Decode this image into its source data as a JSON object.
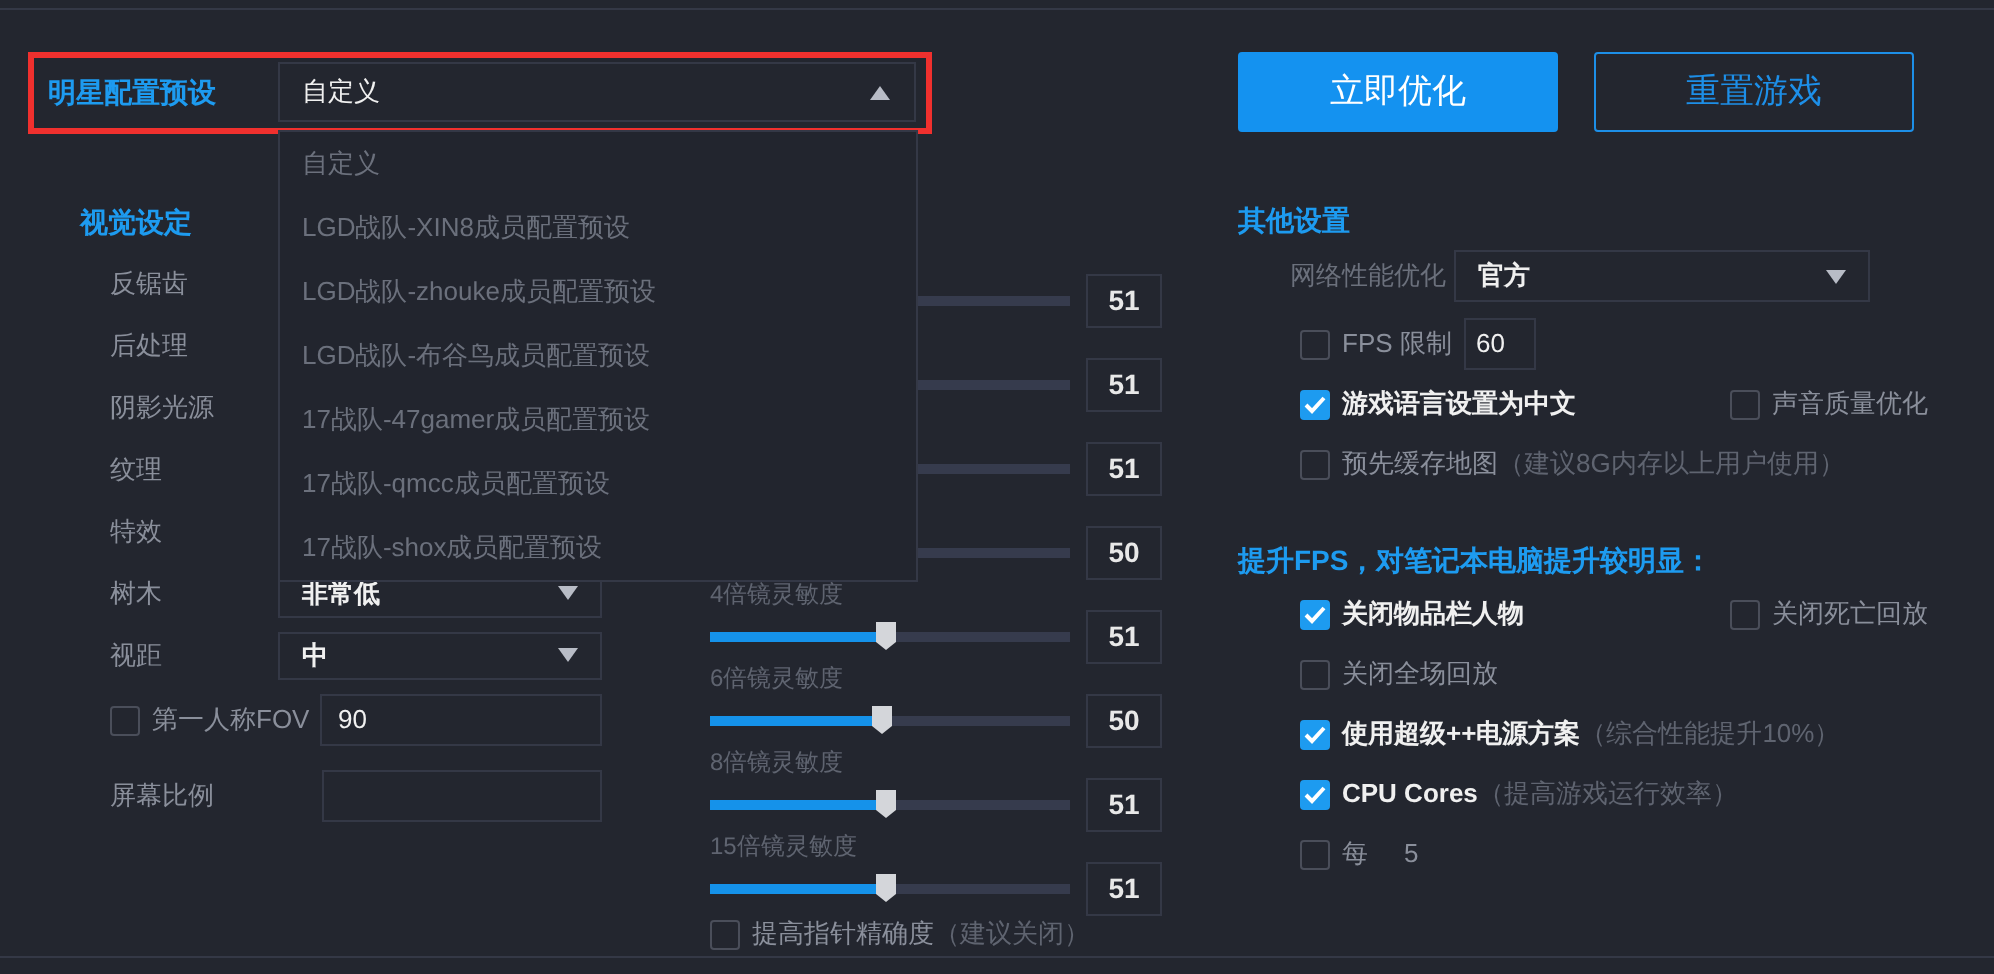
{
  "preset": {
    "label": "明星配置预设",
    "value": "自定义",
    "expanded": true,
    "options": [
      {
        "label": "自定义"
      },
      {
        "label": "LGD战队-XIN8成员配置预设"
      },
      {
        "label": "LGD战队-zhouke成员配置预设"
      },
      {
        "label": "LGD战队-布谷鸟成员配置预设"
      },
      {
        "label": "17战队-47gamer成员配置预设"
      },
      {
        "label": "17战队-qmcc成员配置预设"
      },
      {
        "label": "17战队-shox成员配置预设"
      }
    ]
  },
  "actions": [
    {
      "label": "立即优化",
      "kind": "primary"
    },
    {
      "label": "重置游戏",
      "kind": "secondary"
    }
  ],
  "visual": {
    "title": "视觉设定",
    "settings": [
      {
        "label": "反锯齿"
      },
      {
        "label": "后处理"
      },
      {
        "label": "阴影光源"
      },
      {
        "label": "纹理"
      },
      {
        "label": "特效"
      },
      {
        "label": "树木",
        "value": "非常低"
      },
      {
        "label": "视距",
        "value": "中"
      }
    ],
    "fov": {
      "label": "第一人称FOV",
      "checked": false,
      "value": "90"
    },
    "screen_ratio": {
      "label": "屏幕比例"
    }
  },
  "sensitivity": {
    "sliders": [
      {
        "level": 0.49,
        "reading": "51"
      },
      {
        "level": 0.49,
        "reading": "51"
      },
      {
        "level": 0.49,
        "reading": "51"
      },
      {
        "level": 0.48,
        "reading": "50"
      },
      {
        "label": "4倍镜灵敏度",
        "level": 0.49,
        "reading": "51"
      },
      {
        "label": "6倍镜灵敏度",
        "level": 0.48,
        "reading": "50"
      },
      {
        "label": "8倍镜灵敏度",
        "level": 0.49,
        "reading": "51"
      },
      {
        "label": "15倍镜灵敏度",
        "level": 0.49,
        "reading": "51"
      }
    ],
    "precision": {
      "label": "提高指针精确度",
      "note": "（建议关闭）",
      "checked": false
    }
  },
  "other": {
    "title": "其他设置",
    "network": {
      "label": "网络性能优化",
      "value": "官方"
    },
    "fps_limit": {
      "label": "FPS 限制",
      "checked": false,
      "value": "60"
    },
    "rows": [
      [
        {
          "label": "游戏语言设置为中文",
          "checked": true
        },
        {
          "label": "声音质量优化",
          "checked": false
        }
      ],
      [
        {
          "label": "预先缓存地图",
          "note": "（建议8G内存以上用户使用）",
          "checked": false
        }
      ]
    ]
  },
  "boost": {
    "title": "提升FPS，对笔记本电脑提升较明显：",
    "rows": [
      [
        {
          "label": "关闭物品栏人物",
          "checked": true
        },
        {
          "label": "关闭死亡回放",
          "checked": false
        }
      ],
      [
        {
          "label": "关闭全场回放",
          "checked": false
        }
      ],
      [
        {
          "label": "使用超级++电源方案",
          "note": "（综合性能提升10%）",
          "checked": true
        }
      ],
      [
        {
          "label": "CPU Cores",
          "note": "（提高游戏运行效率）",
          "checked": true
        }
      ],
      [
        {
          "label": "每",
          "value": "5",
          "checked": false
        }
      ]
    ]
  }
}
